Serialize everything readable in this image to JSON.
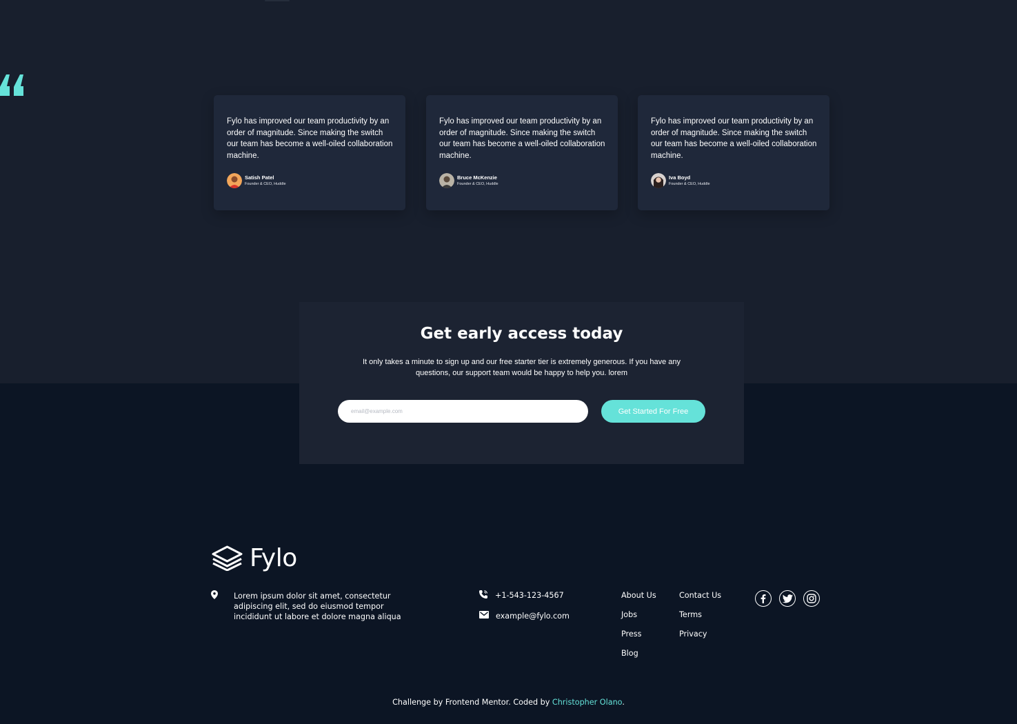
{
  "testimonials": [
    {
      "quote": "Fylo has improved our team productivity by an order of magnitude. Since making the switch our team has become a well-oiled collaboration machine.",
      "name": "Satish Patel",
      "role": "Founder & CEO, Huddle"
    },
    {
      "quote": "Fylo has improved our team productivity by an order of magnitude. Since making the switch our team has become a well-oiled collaboration machine.",
      "name": "Bruce McKenzie",
      "role": "Founder & CEO, Huddle"
    },
    {
      "quote": "Fylo has improved our team productivity by an order of magnitude. Since making the switch our team has become a well-oiled collaboration machine.",
      "name": "Iva Boyd",
      "role": "Founder & CEO, Huddle"
    }
  ],
  "cta": {
    "title": "Get early access today",
    "text": "It only takes a minute to sign up and our free starter tier is extremely generous. If you have any questions, our support team would be happy to help you. lorem",
    "email_placeholder": "email@example.com",
    "button_label": "Get Started For Free"
  },
  "footer": {
    "logo_text": "Fylo",
    "address": "Lorem ipsum dolor sit amet, consectetur adipiscing elit, sed do eiusmod tempor incididunt ut labore et dolore magna aliqua",
    "phone": "+1-543-123-4567",
    "email": "example@fylo.com",
    "links_col1": [
      "About Us",
      "Jobs",
      "Press",
      "Blog"
    ],
    "links_col2": [
      "Contact Us",
      "Terms",
      "Privacy"
    ],
    "social": [
      "facebook-icon",
      "twitter-icon",
      "instagram-icon"
    ]
  },
  "credit": {
    "prefix": "Challenge by Frontend Mentor. Coded by ",
    "author": "Christopher Olano",
    "suffix": "."
  },
  "colors": {
    "accent": "#65e2d9",
    "top_bg": "#181f2d",
    "bottom_bg": "#0c1524",
    "card_bg": "#1f283a",
    "cta_bg": "#1c2332"
  }
}
